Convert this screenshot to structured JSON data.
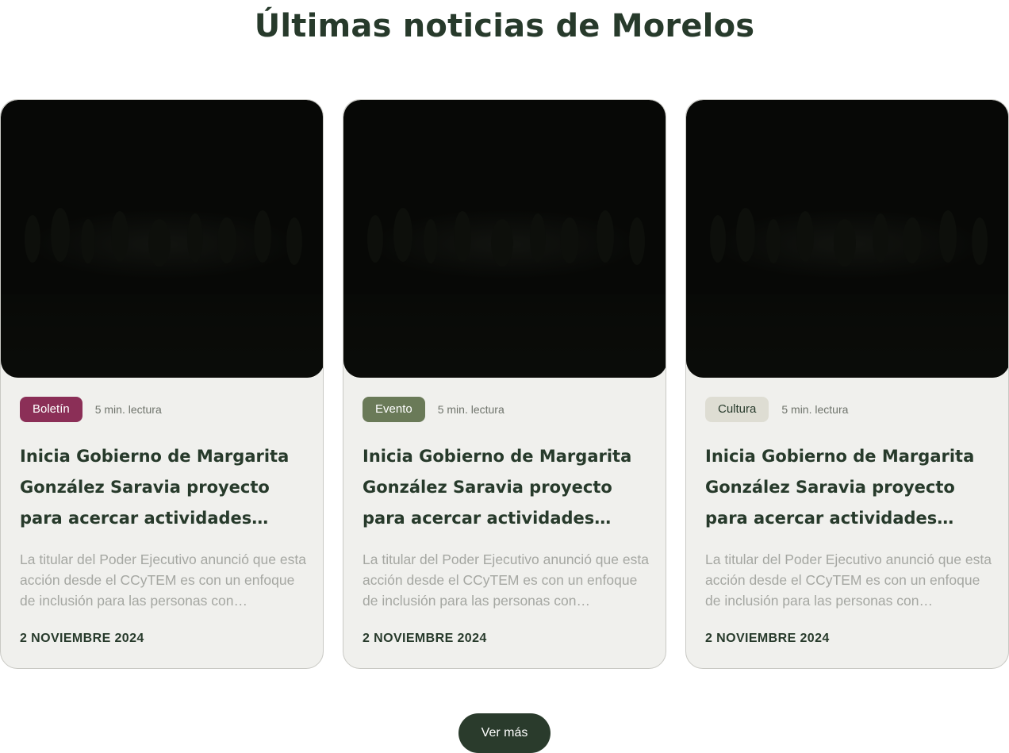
{
  "section": {
    "title": "Últimas noticias de Morelos"
  },
  "colors": {
    "heading": "#273a2b",
    "card_bg": "#f0f0ed",
    "badge_boletin_bg": "#8b2f57",
    "badge_evento_bg": "#6a7a58",
    "badge_cultura_bg": "#deddd3",
    "button_bg": "#2a3b2c"
  },
  "cards": [
    {
      "badge": "Boletín",
      "read_time": "5 min. lectura",
      "title": "Inicia Gobierno de Margarita González Saravia proyecto para acercar actividades científicas a…",
      "excerpt": "La titular del Poder Ejecutivo anunció que esta acción desde el CCyTEM es con un enfoque de inclusión para las personas con…",
      "date": "2 NOVIEMBRE 2024"
    },
    {
      "badge": "Evento",
      "read_time": "5 min. lectura",
      "title": "Inicia Gobierno de Margarita González Saravia proyecto para acercar actividades científicas a…",
      "excerpt": "La titular del Poder Ejecutivo anunció que esta acción desde el CCyTEM es con un enfoque de inclusión para las personas con…",
      "date": "2 NOVIEMBRE 2024"
    },
    {
      "badge": "Cultura",
      "read_time": "5 min. lectura",
      "title": "Inicia Gobierno de Margarita González Saravia proyecto para acercar actividades científicas a…",
      "excerpt": "La titular del Poder Ejecutivo anunció que esta acción desde el CCyTEM es con un enfoque de inclusión para las personas con…",
      "date": "2 NOVIEMBRE 2024"
    }
  ],
  "actions": {
    "more_label": "Ver más"
  }
}
